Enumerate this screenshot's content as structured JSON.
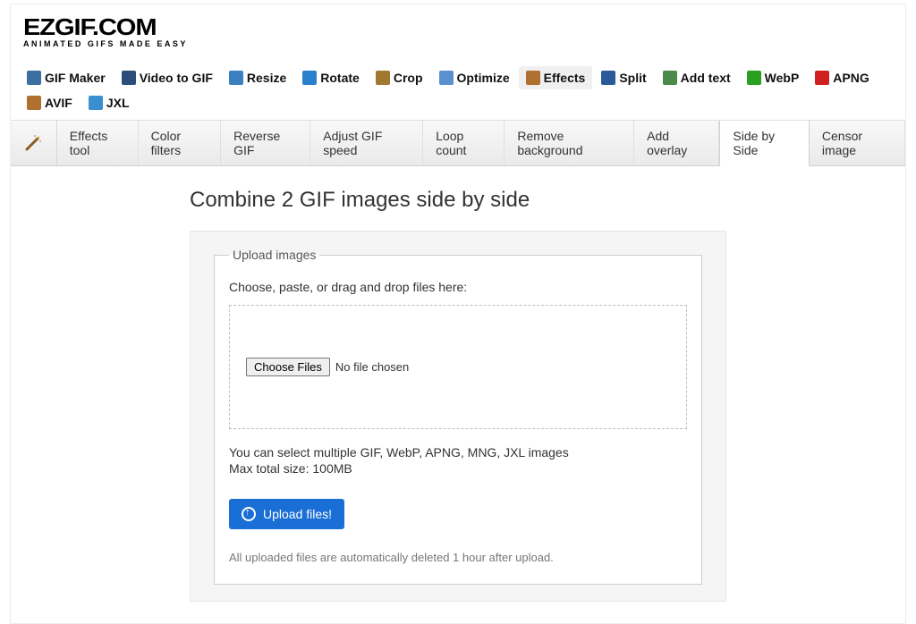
{
  "logo": {
    "main": "EZGIF.COM",
    "sub": "ANIMATED GIFS MADE EASY"
  },
  "mainNav": {
    "items": [
      {
        "label": "GIF Maker",
        "icon": "film-icon",
        "color": "#3a6fa0"
      },
      {
        "label": "Video to GIF",
        "icon": "video-icon",
        "color": "#2a4d7a"
      },
      {
        "label": "Resize",
        "icon": "resize-icon",
        "color": "#3a7fbf"
      },
      {
        "label": "Rotate",
        "icon": "rotate-icon",
        "color": "#2a7fcf"
      },
      {
        "label": "Crop",
        "icon": "crop-icon",
        "color": "#a07830"
      },
      {
        "label": "Optimize",
        "icon": "optimize-icon",
        "color": "#5a8fd0"
      },
      {
        "label": "Effects",
        "icon": "effects-icon",
        "color": "#b07030",
        "active": true
      },
      {
        "label": "Split",
        "icon": "split-icon",
        "color": "#2a5a9a"
      },
      {
        "label": "Add text",
        "icon": "text-icon",
        "color": "#4a8a4a"
      },
      {
        "label": "WebP",
        "icon": "webp-icon",
        "color": "#2aa020"
      },
      {
        "label": "APNG",
        "icon": "apng-icon",
        "color": "#d02020"
      },
      {
        "label": "AVIF",
        "icon": "avif-icon",
        "color": "#b07030"
      },
      {
        "label": "JXL",
        "icon": "jxl-icon",
        "color": "#3a8fd0"
      }
    ]
  },
  "subNav": {
    "items": [
      {
        "label": "Effects tool"
      },
      {
        "label": "Color filters"
      },
      {
        "label": "Reverse GIF"
      },
      {
        "label": "Adjust GIF speed"
      },
      {
        "label": "Loop count"
      },
      {
        "label": "Remove background"
      },
      {
        "label": "Add overlay"
      },
      {
        "label": "Side by Side",
        "active": true
      },
      {
        "label": "Censor image"
      }
    ]
  },
  "page": {
    "title": "Combine 2 GIF images side by side"
  },
  "upload": {
    "legend": "Upload images",
    "instruction": "Choose, paste, or drag and drop files here:",
    "chooseLabel": "Choose Files",
    "noFile": "No file chosen",
    "info1": "You can select multiple GIF, WebP, APNG, MNG, JXL images",
    "info2": "Max total size: 100MB",
    "button": "Upload files!",
    "footnote": "All uploaded files are automatically deleted 1 hour after upload."
  }
}
